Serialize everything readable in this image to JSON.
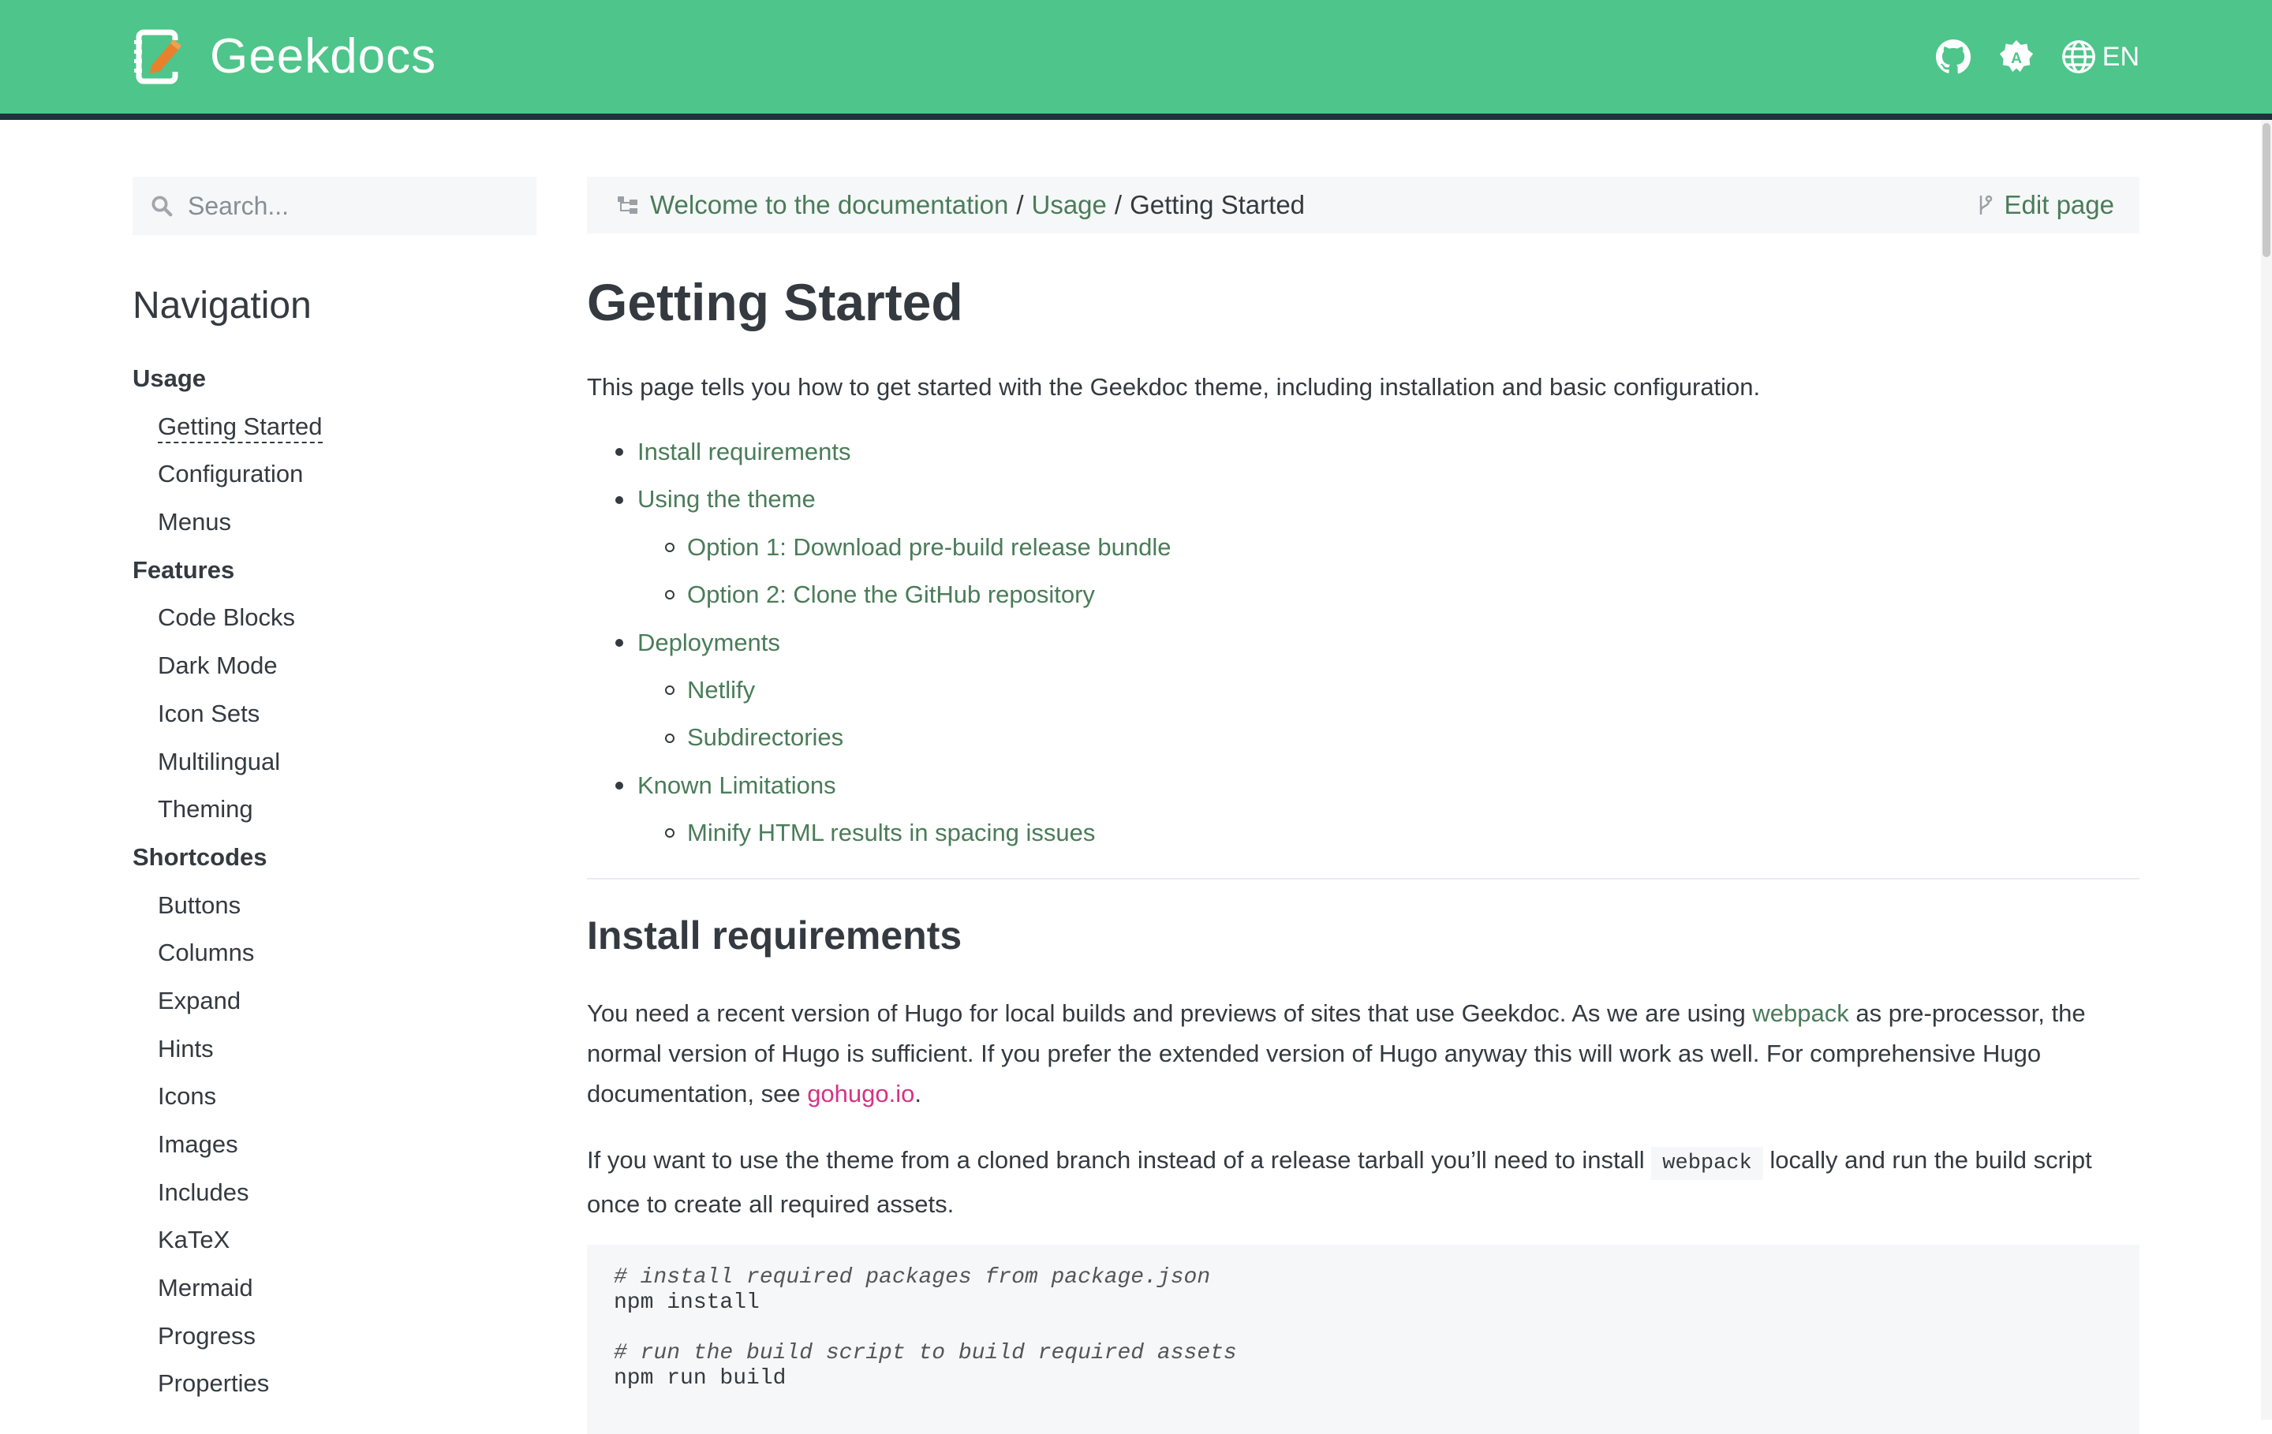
{
  "header": {
    "brand_title": "Geekdocs",
    "language": "EN",
    "icons": [
      "github-icon",
      "theme-toggle-icon",
      "globe-icon"
    ],
    "background_color": "#4ec58a",
    "border_color": "#20323d"
  },
  "sidebar": {
    "search_placeholder": "Search...",
    "heading": "Navigation",
    "sections": [
      {
        "label": "Usage",
        "items": [
          {
            "label": "Getting Started",
            "active": true
          },
          {
            "label": "Configuration"
          },
          {
            "label": "Menus"
          }
        ]
      },
      {
        "label": "Features",
        "items": [
          {
            "label": "Code Blocks"
          },
          {
            "label": "Dark Mode"
          },
          {
            "label": "Icon Sets"
          },
          {
            "label": "Multilingual"
          },
          {
            "label": "Theming"
          }
        ]
      },
      {
        "label": "Shortcodes",
        "items": [
          {
            "label": "Buttons"
          },
          {
            "label": "Columns"
          },
          {
            "label": "Expand"
          },
          {
            "label": "Hints"
          },
          {
            "label": "Icons"
          },
          {
            "label": "Images"
          },
          {
            "label": "Includes"
          },
          {
            "label": "KaTeX"
          },
          {
            "label": "Mermaid"
          },
          {
            "label": "Progress"
          },
          {
            "label": "Properties"
          }
        ]
      }
    ]
  },
  "breadcrumb": {
    "items": [
      "Welcome to the documentation",
      "Usage"
    ],
    "separator": "/",
    "current": "Getting Started",
    "edit_label": "Edit page"
  },
  "main": {
    "title": "Getting Started",
    "intro": "This page tells you how to get started with the Geekdoc theme, including installation and basic configuration.",
    "toc": [
      {
        "label": "Install requirements",
        "children": []
      },
      {
        "label": "Using the theme",
        "children": [
          "Option 1: Download pre-build release bundle",
          "Option 2: Clone the GitHub repository"
        ]
      },
      {
        "label": "Deployments",
        "children": [
          "Netlify",
          "Subdirectories"
        ]
      },
      {
        "label": "Known Limitations",
        "children": [
          "Minify HTML results in spacing issues"
        ]
      }
    ],
    "section_title": "Install requirements",
    "p1": {
      "text_a": "You need a recent version of Hugo for local builds and previews of sites that use Geekdoc. As we are using ",
      "link_a": "webpack",
      "text_b": " as pre-processor, the normal version of Hugo is sufficient. If you prefer the extended version of Hugo anyway this will work as well. For comprehensive Hugo documentation, see ",
      "link_b": "gohugo.io",
      "text_c": "."
    },
    "p2": {
      "text_a": "If you want to use the theme from a cloned branch instead of a release tarball you’ll need to install ",
      "code": "webpack",
      "text_b": " locally and run the build script once to create all required assets."
    },
    "code_lines": [
      {
        "text": "# install required packages from package.json",
        "comment": true
      },
      {
        "text": "npm install",
        "comment": false
      },
      {
        "text": "",
        "comment": false
      },
      {
        "text": "# run the build script to build required assets",
        "comment": true
      },
      {
        "text": "npm run build",
        "comment": false
      }
    ],
    "link_color": "#4a7c59",
    "external_link_color": "#d63384"
  }
}
